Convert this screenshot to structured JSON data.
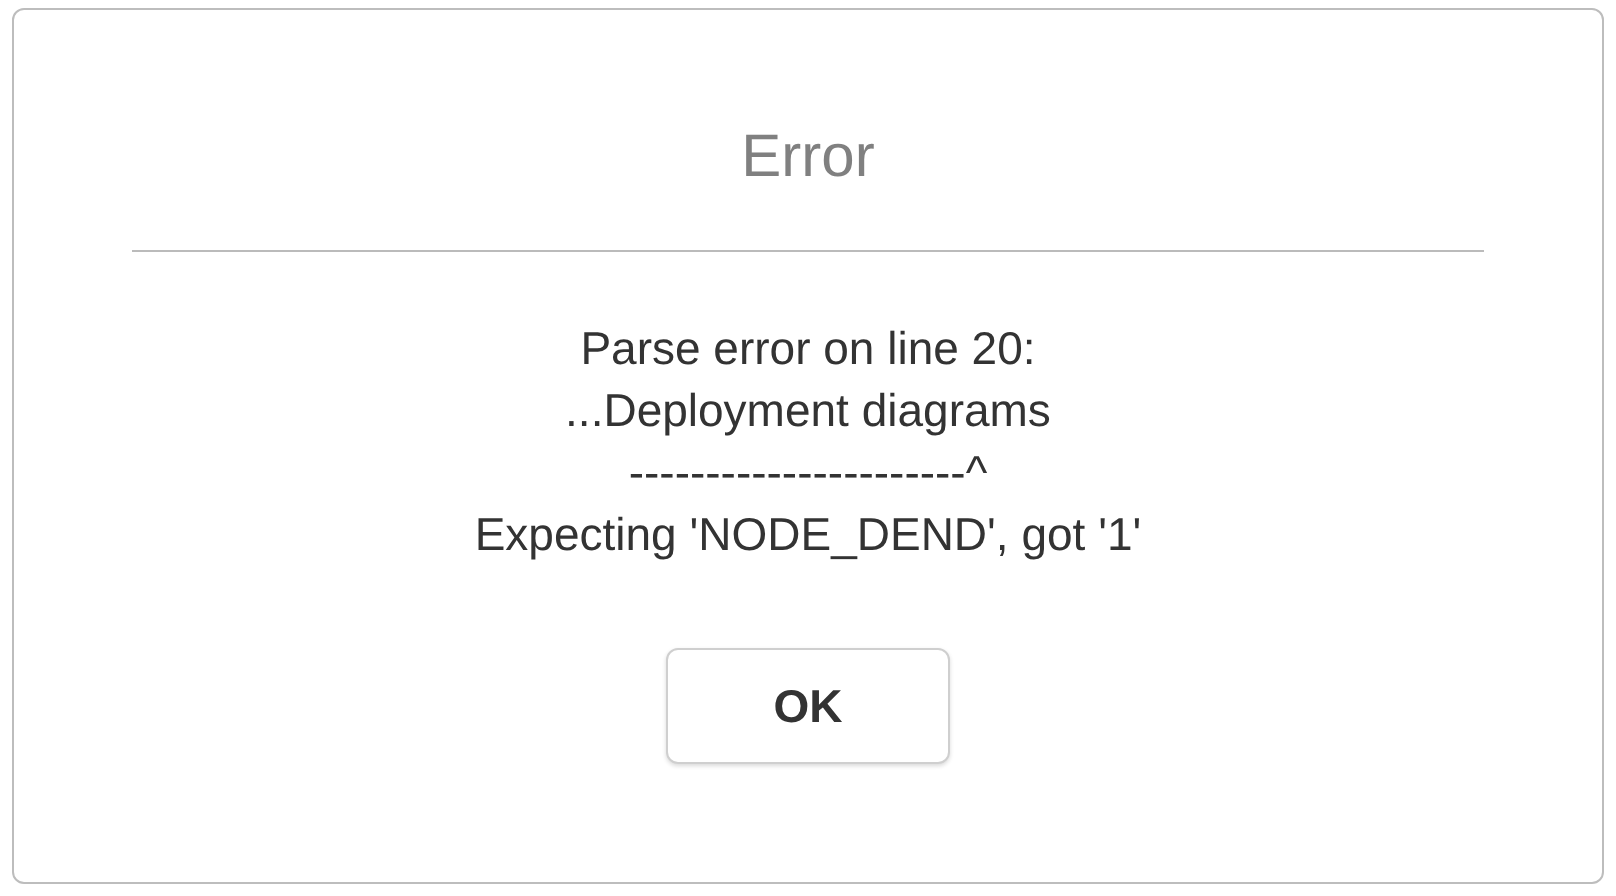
{
  "dialog": {
    "title": "Error",
    "message_lines": [
      "Parse error on line 20:",
      "...Deployment diagrams",
      "----------------------^",
      "Expecting 'NODE_DEND', got '1'"
    ],
    "buttons": [
      {
        "label": "OK"
      }
    ]
  }
}
